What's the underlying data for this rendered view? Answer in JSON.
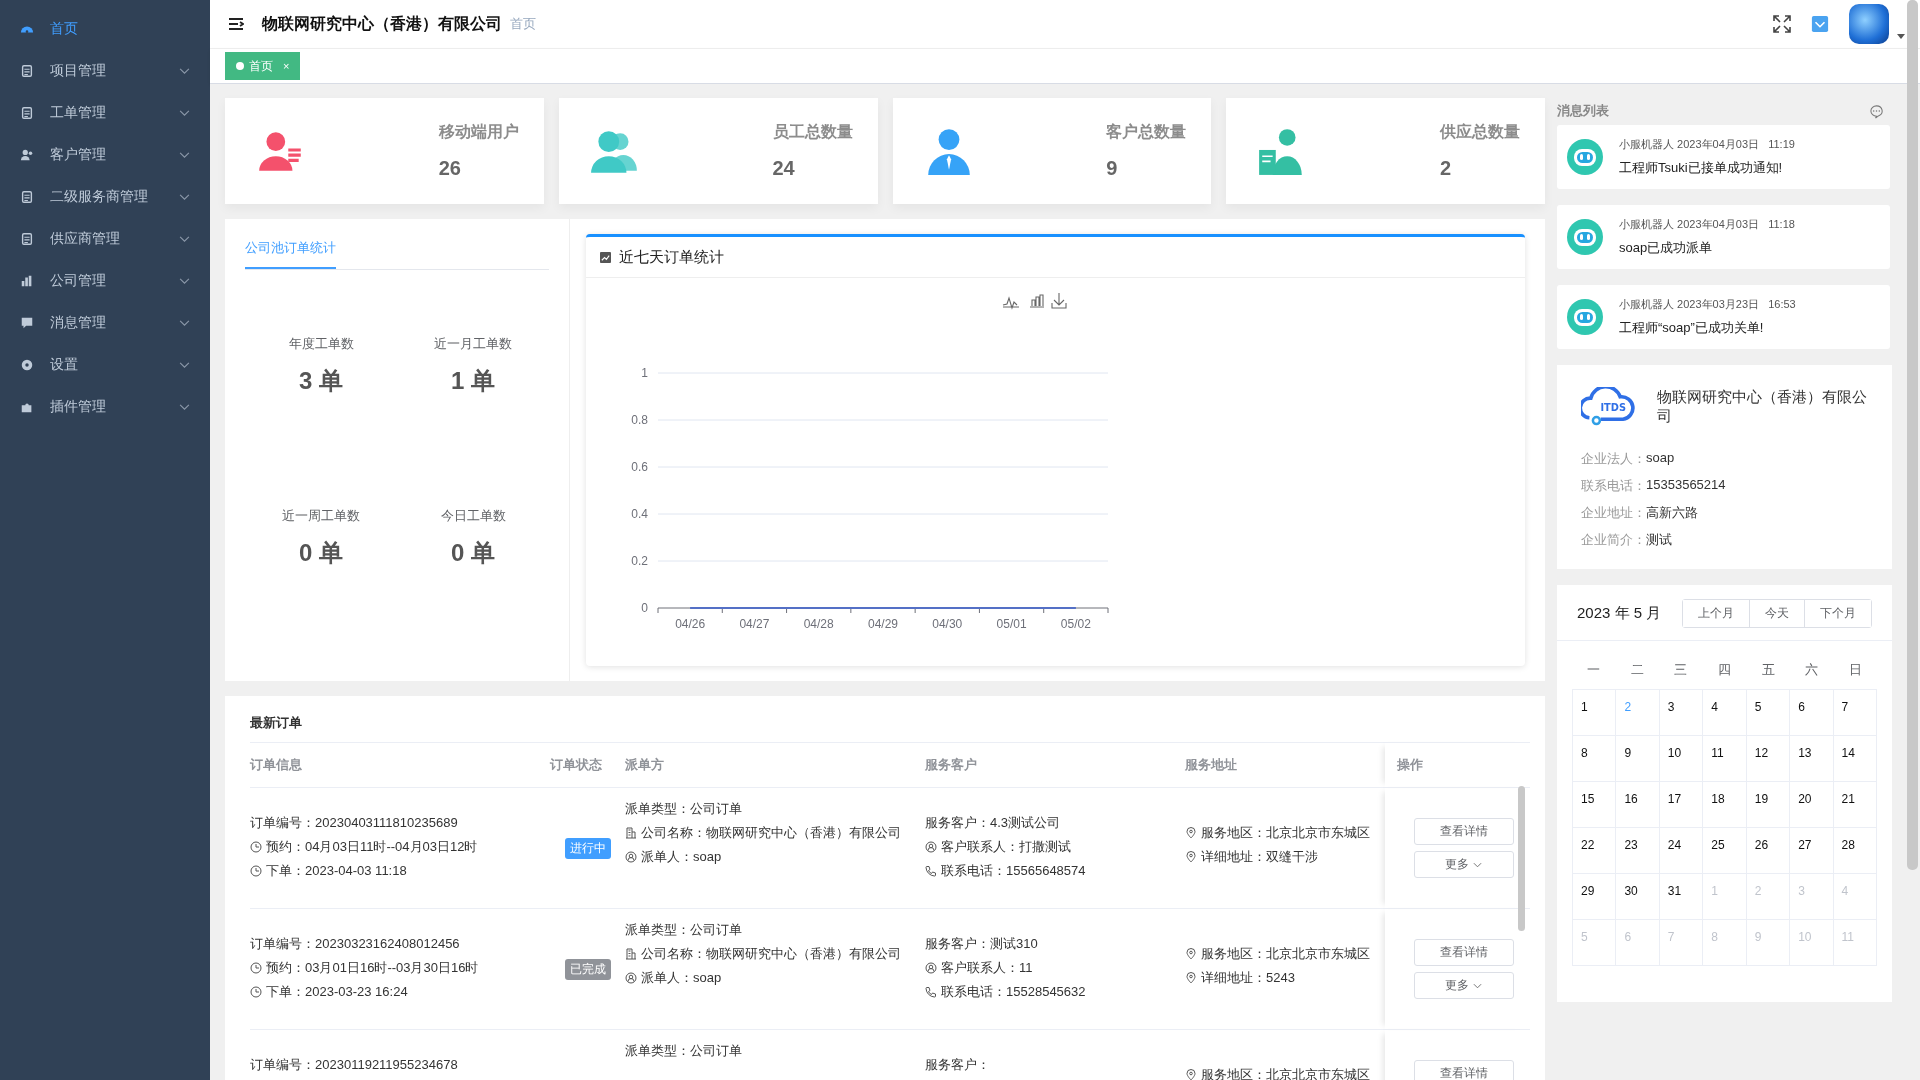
{
  "sidebar": {
    "items": [
      {
        "label": "首页",
        "selected": true,
        "expandable": false
      },
      {
        "label": "项目管理",
        "selected": false,
        "expandable": true
      },
      {
        "label": "工单管理",
        "selected": false,
        "expandable": true
      },
      {
        "label": "客户管理",
        "selected": false,
        "expandable": true
      },
      {
        "label": "二级服务商管理",
        "selected": false,
        "expandable": true
      },
      {
        "label": "供应商管理",
        "selected": false,
        "expandable": true
      },
      {
        "label": "公司管理",
        "selected": false,
        "expandable": true
      },
      {
        "label": "消息管理",
        "selected": false,
        "expandable": true
      },
      {
        "label": "设置",
        "selected": false,
        "expandable": true
      },
      {
        "label": "插件管理",
        "selected": false,
        "expandable": true
      }
    ]
  },
  "header": {
    "title": "物联网研究中心（香港）有限公司",
    "breadcrumb": "首页"
  },
  "tags": [
    {
      "label": "首页",
      "selected": true,
      "close": "×"
    }
  ],
  "stats": [
    {
      "label": "移动端用户",
      "value": "26",
      "color": "#f4516c"
    },
    {
      "label": "员工总数量",
      "value": "24",
      "color": "#40c9c6"
    },
    {
      "label": "客户总数量",
      "value": "9",
      "color": "#36a3f7"
    },
    {
      "label": "供应总数量",
      "value": "2",
      "color": "#34bfa3"
    }
  ],
  "pool": {
    "tabs": [
      {
        "label": "公司池订单统计",
        "selected": true
      }
    ],
    "metrics": [
      {
        "label": "年度工单数",
        "value": "3 单"
      },
      {
        "label": "近一月工单数",
        "value": "1 单"
      },
      {
        "label": "近一周工单数",
        "value": "0 单"
      },
      {
        "label": "今日工单数",
        "value": "0 单"
      }
    ]
  },
  "week_chart": {
    "title": "近七天订单统计",
    "chart_data": {
      "type": "line",
      "categories": [
        "04/26",
        "04/27",
        "04/28",
        "04/29",
        "04/30",
        "05/01",
        "05/02"
      ],
      "series": [
        {
          "color": "#5470c6",
          "values": [
            0,
            0,
            0,
            0,
            0,
            0,
            0
          ]
        }
      ],
      "grid": true,
      "ylim": [
        0,
        1
      ],
      "yticks": [
        0,
        0.2,
        0.4,
        0.6,
        0.8,
        1
      ]
    }
  },
  "orders": {
    "title": "最新订单",
    "columns": [
      "订单信息",
      "订单状态",
      "派单方",
      "服务客户",
      "服务地址",
      "操作"
    ],
    "rows": [
      {
        "order_no": "订单编号：20230403111810235689",
        "appointment": "预约：04月03日11时--04月03日12时",
        "placed": "下单：2023-04-03 11:18",
        "status": "进行中",
        "color": "#409eff",
        "dispatch_type": "派单类型：公司订单",
        "company": "公司名称：物联网研究中心（香港）有限公司",
        "dispatcher": "派单人：soap",
        "customer": "服务客户：4.3测试公司",
        "contact": "客户联系人：打撒测试",
        "phone": "联系电话：15565648574",
        "area": "服务地区：北京北京市东城区",
        "address": "详细地址：双缝干涉",
        "detail": "查看详情",
        "more": "更多"
      },
      {
        "order_no": "订单编号：20230323162408012456",
        "appointment": "预约：03月01日16时--03月30日16时",
        "placed": "下单：2023-03-23 16:24",
        "status": "已完成",
        "color": "#909399",
        "dispatch_type": "派单类型：公司订单",
        "company": "公司名称：物联网研究中心（香港）有限公司",
        "dispatcher": "派单人：soap",
        "customer": "服务客户：测试310",
        "contact": "客户联系人：11",
        "phone": "联系电话：15528545632",
        "area": "服务地区：北京北京市东城区",
        "address": "详细地址：5243",
        "detail": "查看详情",
        "more": "更多"
      },
      {
        "order_no": "订单编号：20230119211955234678",
        "dispatch_type": "派单类型：公司订单",
        "customer": "服务客户：",
        "area": "服务地区：北京北京市东城区",
        "detail": "查看详情"
      }
    ]
  },
  "messages": {
    "title": "消息列表",
    "items": [
      {
        "sender": "小服机器人",
        "date": "2023年04月03日",
        "time": "11:19",
        "text": "工程师Tsuki已接单成功通知!"
      },
      {
        "sender": "小服机器人",
        "date": "2023年04月03日",
        "time": "11:18",
        "text": "soap已成功派单"
      },
      {
        "sender": "小服机器人",
        "date": "2023年03月23日",
        "time": "16:53",
        "text": "工程师“soap”已成功关单!"
      }
    ]
  },
  "company": {
    "logo_text": "ITDS",
    "name": "物联网研究中心（香港）有限公司",
    "fields": [
      {
        "label": "企业法人：",
        "value": "soap"
      },
      {
        "label": "联系电话：",
        "value": "15353565214"
      },
      {
        "label": "企业地址：",
        "value": "高新六路"
      },
      {
        "label": "企业简介：",
        "value": "测试"
      }
    ]
  },
  "calendar": {
    "title": "2023 年 5 月",
    "buttons": [
      "上个月",
      "今天",
      "下个月"
    ],
    "weekdays": [
      "一",
      "二",
      "三",
      "四",
      "五",
      "六",
      "日"
    ],
    "weeks": [
      [
        {
          "day": "1",
          "current": true,
          "today": false
        },
        {
          "day": "2",
          "current": true,
          "today": true
        },
        {
          "day": "3",
          "current": true,
          "today": false
        },
        {
          "day": "4",
          "current": true,
          "today": false
        },
        {
          "day": "5",
          "current": true,
          "today": false
        },
        {
          "day": "6",
          "current": true,
          "today": false
        },
        {
          "day": "7",
          "current": true,
          "today": false
        }
      ],
      [
        {
          "day": "8",
          "current": true,
          "today": false
        },
        {
          "day": "9",
          "current": true,
          "today": false
        },
        {
          "day": "10",
          "current": true,
          "today": false
        },
        {
          "day": "11",
          "current": true,
          "today": false
        },
        {
          "day": "12",
          "current": true,
          "today": false
        },
        {
          "day": "13",
          "current": true,
          "today": false
        },
        {
          "day": "14",
          "current": true,
          "today": false
        }
      ],
      [
        {
          "day": "15",
          "current": true,
          "today": false
        },
        {
          "day": "16",
          "current": true,
          "today": false
        },
        {
          "day": "17",
          "current": true,
          "today": false
        },
        {
          "day": "18",
          "current": true,
          "today": false
        },
        {
          "day": "19",
          "current": true,
          "today": false
        },
        {
          "day": "20",
          "current": true,
          "today": false
        },
        {
          "day": "21",
          "current": true,
          "today": false
        }
      ],
      [
        {
          "day": "22",
          "current": true,
          "today": false
        },
        {
          "day": "23",
          "current": true,
          "today": false
        },
        {
          "day": "24",
          "current": true,
          "today": false
        },
        {
          "day": "25",
          "current": true,
          "today": false
        },
        {
          "day": "26",
          "current": true,
          "today": false
        },
        {
          "day": "27",
          "current": true,
          "today": false
        },
        {
          "day": "28",
          "current": true,
          "today": false
        }
      ],
      [
        {
          "day": "29",
          "current": true,
          "today": false
        },
        {
          "day": "30",
          "current": true,
          "today": false
        },
        {
          "day": "31",
          "current": true,
          "today": false
        },
        {
          "day": "1",
          "current": false,
          "today": false
        },
        {
          "day": "2",
          "current": false,
          "today": false
        },
        {
          "day": "3",
          "current": false,
          "today": false
        },
        {
          "day": "4",
          "current": false,
          "today": false
        }
      ],
      [
        {
          "day": "5",
          "current": false,
          "today": false
        },
        {
          "day": "6",
          "current": false,
          "today": false
        },
        {
          "day": "7",
          "current": false,
          "today": false
        },
        {
          "day": "8",
          "current": false,
          "today": false
        },
        {
          "day": "9",
          "current": false,
          "today": false
        },
        {
          "day": "10",
          "current": false,
          "today": false
        },
        {
          "day": "11",
          "current": false,
          "today": false
        }
      ]
    ]
  }
}
